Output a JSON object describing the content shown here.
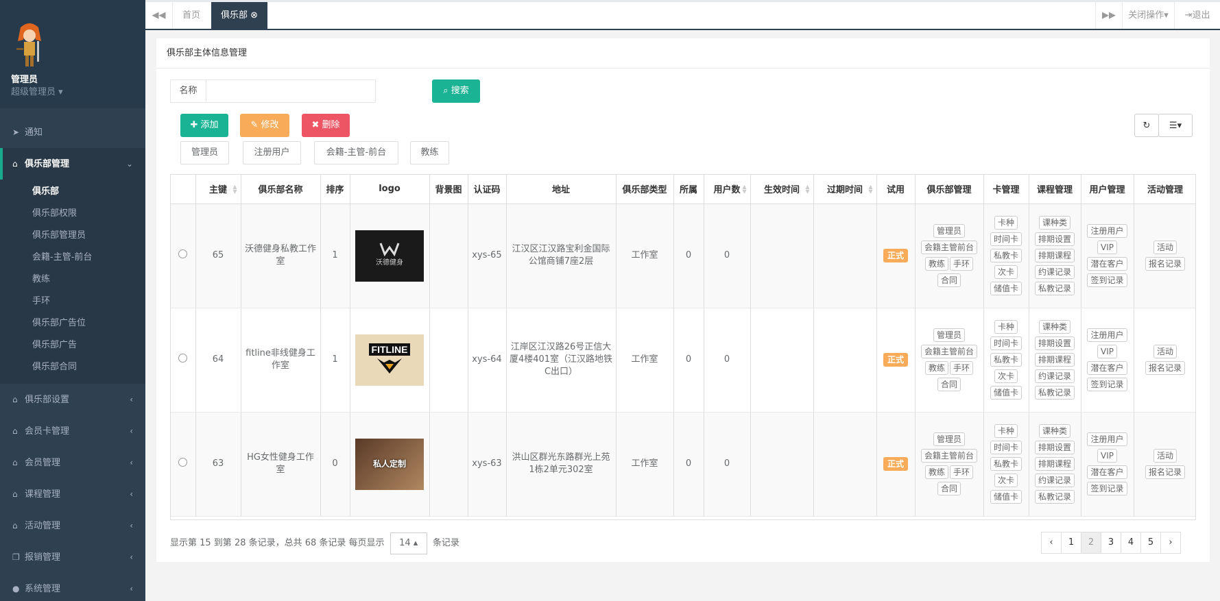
{
  "user": {
    "name": "管理员",
    "role": "超级管理员"
  },
  "nav": {
    "notify": "通知",
    "club_mgmt": "俱乐部管理",
    "sub_items": [
      "俱乐部",
      "俱乐部权限",
      "俱乐部管理员",
      "会籍-主管-前台",
      "教练",
      "手环",
      "俱乐部广告位",
      "俱乐部广告",
      "俱乐部合同"
    ],
    "groups": [
      "俱乐部设置",
      "会员卡管理",
      "会员管理",
      "课程管理",
      "活动管理",
      "报销管理",
      "系统管理"
    ]
  },
  "topbar": {
    "home": "首页",
    "current_tab": "俱乐部",
    "close_ops": "关闭操作",
    "logout": "退出"
  },
  "panel_title": "俱乐部主体信息管理",
  "search": {
    "label": "名称",
    "value": "",
    "button": "搜索"
  },
  "actions": {
    "add": "添加",
    "edit": "修改",
    "delete": "删除"
  },
  "filters": [
    "管理员",
    "注册用户",
    "会籍-主管-前台",
    "教练"
  ],
  "columns": [
    "主键",
    "俱乐部名称",
    "排序",
    "logo",
    "背景图",
    "认证码",
    "地址",
    "俱乐部类型",
    "所属",
    "用户数",
    "生效时间",
    "过期时间",
    "试用",
    "俱乐部管理",
    "卡管理",
    "课程管理",
    "用户管理",
    "活动管理"
  ],
  "rows": [
    {
      "id": "65",
      "name": "沃德健身私教工作室",
      "sort": "1",
      "logo_text": "沃德健身",
      "code": "xys-65",
      "address": "江汉区江汉路宝利金国际公馆商铺7座2层",
      "type": "工作室",
      "belong": "0",
      "users": "0",
      "trial": "正式"
    },
    {
      "id": "64",
      "name": "fitline非线健身工作室",
      "sort": "1",
      "logo_text": "FITLINE",
      "code": "xys-64",
      "address": "江岸区江汉路26号正信大厦4楼401室（江汉路地铁C出口）",
      "type": "工作室",
      "belong": "0",
      "users": "0",
      "trial": "正式"
    },
    {
      "id": "63",
      "name": "HG女性健身工作室",
      "sort": "0",
      "logo_text": "私人定制",
      "code": "xys-63",
      "address": "洪山区群光东路群光上苑1栋2单元302室",
      "type": "工作室",
      "belong": "0",
      "users": "0",
      "trial": "正式"
    }
  ],
  "ops": {
    "club": [
      "管理员",
      "会籍主管前台",
      "教练",
      "手环",
      "合同"
    ],
    "card": [
      "卡种",
      "时间卡",
      "私教卡",
      "次卡",
      "储值卡"
    ],
    "course": [
      "课种类",
      "排期设置",
      "排期课程",
      "约课记录",
      "私教记录"
    ],
    "user": [
      "注册用户",
      "VIP",
      "潜在客户",
      "签到记录"
    ],
    "activity": [
      "活动",
      "报名记录"
    ]
  },
  "footer": {
    "summary": "显示第 15 到第 28 条记录，总共 68 条记录 每页显示",
    "page_size": "14",
    "suffix": "条记录"
  },
  "pagination": [
    "‹",
    "1",
    "2",
    "3",
    "4",
    "5",
    "›"
  ],
  "colors": {
    "sidebar": "#2f4050",
    "primary": "#1ab394",
    "warning": "#f8ac59",
    "danger": "#ed5565"
  }
}
